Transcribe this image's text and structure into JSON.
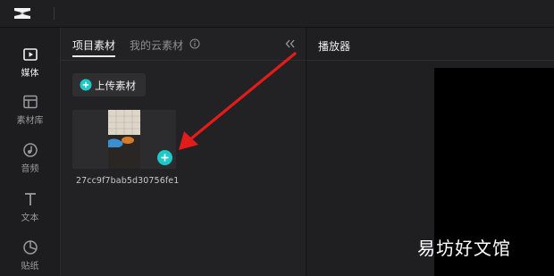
{
  "colors": {
    "accent": "#1ec8c8",
    "arrow": "#e21b1b",
    "background": "#1b1b1d",
    "panel": "#222224"
  },
  "app": {
    "logo_icon": "capcut-logo-icon"
  },
  "sidebar": {
    "items": [
      {
        "label": "媒体",
        "icon": "media-play-icon",
        "active": true
      },
      {
        "label": "素材库",
        "icon": "library-grid-icon",
        "active": false
      },
      {
        "label": "音频",
        "icon": "audio-note-icon",
        "active": false
      },
      {
        "label": "文本",
        "icon": "text-t-icon",
        "active": false
      },
      {
        "label": "贴纸",
        "icon": "sticker-icon",
        "active": false
      }
    ]
  },
  "media_panel": {
    "tabs": [
      {
        "label": "项目素材",
        "active": true
      },
      {
        "label": "我的云素材",
        "active": false
      }
    ],
    "upload_label": "上传素材",
    "items": [
      {
        "filename": "27cc9f7bab5d30756fe1"
      }
    ]
  },
  "player": {
    "title": "播放器"
  },
  "watermark": "易坊好文馆"
}
